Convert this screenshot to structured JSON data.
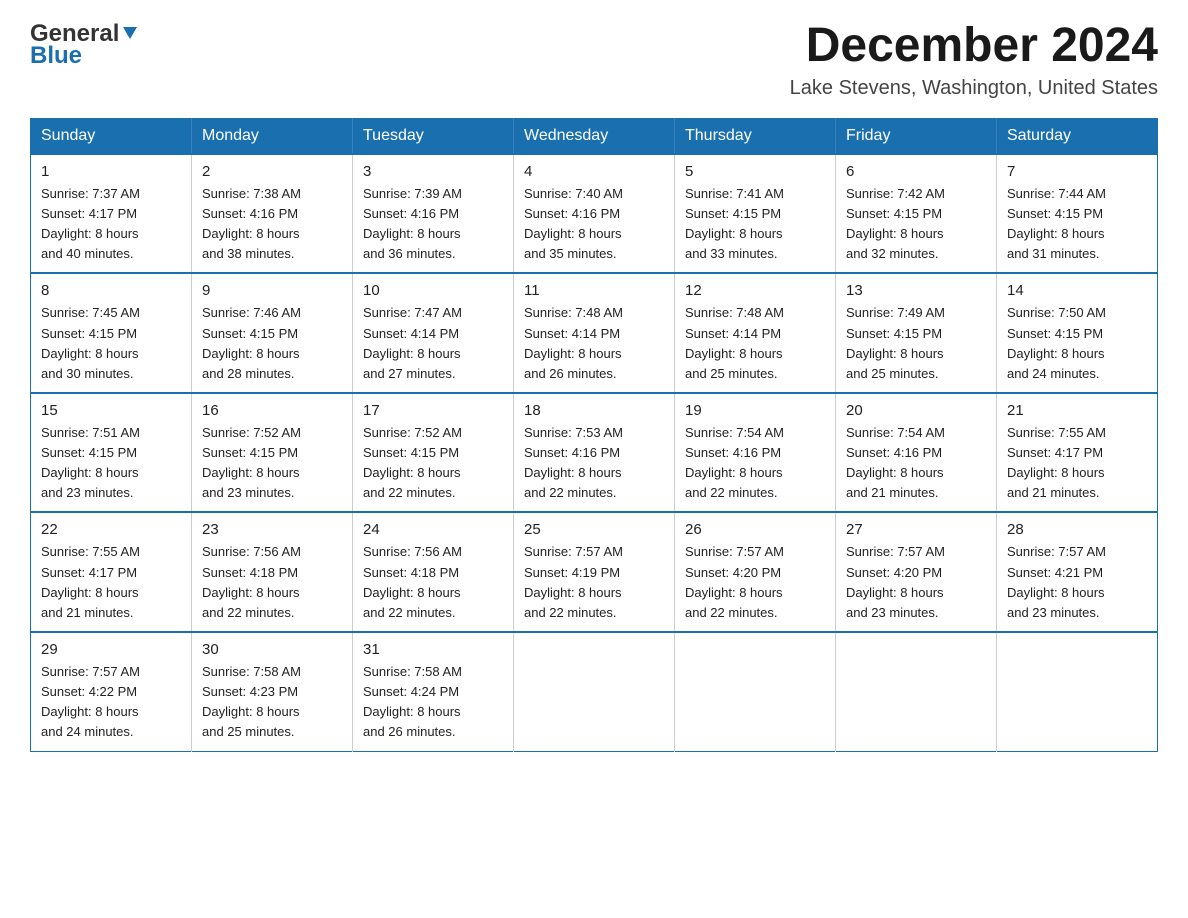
{
  "logo": {
    "general": "General",
    "blue": "Blue"
  },
  "title": {
    "month": "December 2024",
    "location": "Lake Stevens, Washington, United States"
  },
  "header": {
    "days": [
      "Sunday",
      "Monday",
      "Tuesday",
      "Wednesday",
      "Thursday",
      "Friday",
      "Saturday"
    ]
  },
  "weeks": [
    [
      {
        "day": "1",
        "sunrise": "7:37 AM",
        "sunset": "4:17 PM",
        "daylight": "8 hours and 40 minutes."
      },
      {
        "day": "2",
        "sunrise": "7:38 AM",
        "sunset": "4:16 PM",
        "daylight": "8 hours and 38 minutes."
      },
      {
        "day": "3",
        "sunrise": "7:39 AM",
        "sunset": "4:16 PM",
        "daylight": "8 hours and 36 minutes."
      },
      {
        "day": "4",
        "sunrise": "7:40 AM",
        "sunset": "4:16 PM",
        "daylight": "8 hours and 35 minutes."
      },
      {
        "day": "5",
        "sunrise": "7:41 AM",
        "sunset": "4:15 PM",
        "daylight": "8 hours and 33 minutes."
      },
      {
        "day": "6",
        "sunrise": "7:42 AM",
        "sunset": "4:15 PM",
        "daylight": "8 hours and 32 minutes."
      },
      {
        "day": "7",
        "sunrise": "7:44 AM",
        "sunset": "4:15 PM",
        "daylight": "8 hours and 31 minutes."
      }
    ],
    [
      {
        "day": "8",
        "sunrise": "7:45 AM",
        "sunset": "4:15 PM",
        "daylight": "8 hours and 30 minutes."
      },
      {
        "day": "9",
        "sunrise": "7:46 AM",
        "sunset": "4:15 PM",
        "daylight": "8 hours and 28 minutes."
      },
      {
        "day": "10",
        "sunrise": "7:47 AM",
        "sunset": "4:14 PM",
        "daylight": "8 hours and 27 minutes."
      },
      {
        "day": "11",
        "sunrise": "7:48 AM",
        "sunset": "4:14 PM",
        "daylight": "8 hours and 26 minutes."
      },
      {
        "day": "12",
        "sunrise": "7:48 AM",
        "sunset": "4:14 PM",
        "daylight": "8 hours and 25 minutes."
      },
      {
        "day": "13",
        "sunrise": "7:49 AM",
        "sunset": "4:15 PM",
        "daylight": "8 hours and 25 minutes."
      },
      {
        "day": "14",
        "sunrise": "7:50 AM",
        "sunset": "4:15 PM",
        "daylight": "8 hours and 24 minutes."
      }
    ],
    [
      {
        "day": "15",
        "sunrise": "7:51 AM",
        "sunset": "4:15 PM",
        "daylight": "8 hours and 23 minutes."
      },
      {
        "day": "16",
        "sunrise": "7:52 AM",
        "sunset": "4:15 PM",
        "daylight": "8 hours and 23 minutes."
      },
      {
        "day": "17",
        "sunrise": "7:52 AM",
        "sunset": "4:15 PM",
        "daylight": "8 hours and 22 minutes."
      },
      {
        "day": "18",
        "sunrise": "7:53 AM",
        "sunset": "4:16 PM",
        "daylight": "8 hours and 22 minutes."
      },
      {
        "day": "19",
        "sunrise": "7:54 AM",
        "sunset": "4:16 PM",
        "daylight": "8 hours and 22 minutes."
      },
      {
        "day": "20",
        "sunrise": "7:54 AM",
        "sunset": "4:16 PM",
        "daylight": "8 hours and 21 minutes."
      },
      {
        "day": "21",
        "sunrise": "7:55 AM",
        "sunset": "4:17 PM",
        "daylight": "8 hours and 21 minutes."
      }
    ],
    [
      {
        "day": "22",
        "sunrise": "7:55 AM",
        "sunset": "4:17 PM",
        "daylight": "8 hours and 21 minutes."
      },
      {
        "day": "23",
        "sunrise": "7:56 AM",
        "sunset": "4:18 PM",
        "daylight": "8 hours and 22 minutes."
      },
      {
        "day": "24",
        "sunrise": "7:56 AM",
        "sunset": "4:18 PM",
        "daylight": "8 hours and 22 minutes."
      },
      {
        "day": "25",
        "sunrise": "7:57 AM",
        "sunset": "4:19 PM",
        "daylight": "8 hours and 22 minutes."
      },
      {
        "day": "26",
        "sunrise": "7:57 AM",
        "sunset": "4:20 PM",
        "daylight": "8 hours and 22 minutes."
      },
      {
        "day": "27",
        "sunrise": "7:57 AM",
        "sunset": "4:20 PM",
        "daylight": "8 hours and 23 minutes."
      },
      {
        "day": "28",
        "sunrise": "7:57 AM",
        "sunset": "4:21 PM",
        "daylight": "8 hours and 23 minutes."
      }
    ],
    [
      {
        "day": "29",
        "sunrise": "7:57 AM",
        "sunset": "4:22 PM",
        "daylight": "8 hours and 24 minutes."
      },
      {
        "day": "30",
        "sunrise": "7:58 AM",
        "sunset": "4:23 PM",
        "daylight": "8 hours and 25 minutes."
      },
      {
        "day": "31",
        "sunrise": "7:58 AM",
        "sunset": "4:24 PM",
        "daylight": "8 hours and 26 minutes."
      },
      null,
      null,
      null,
      null
    ]
  ]
}
